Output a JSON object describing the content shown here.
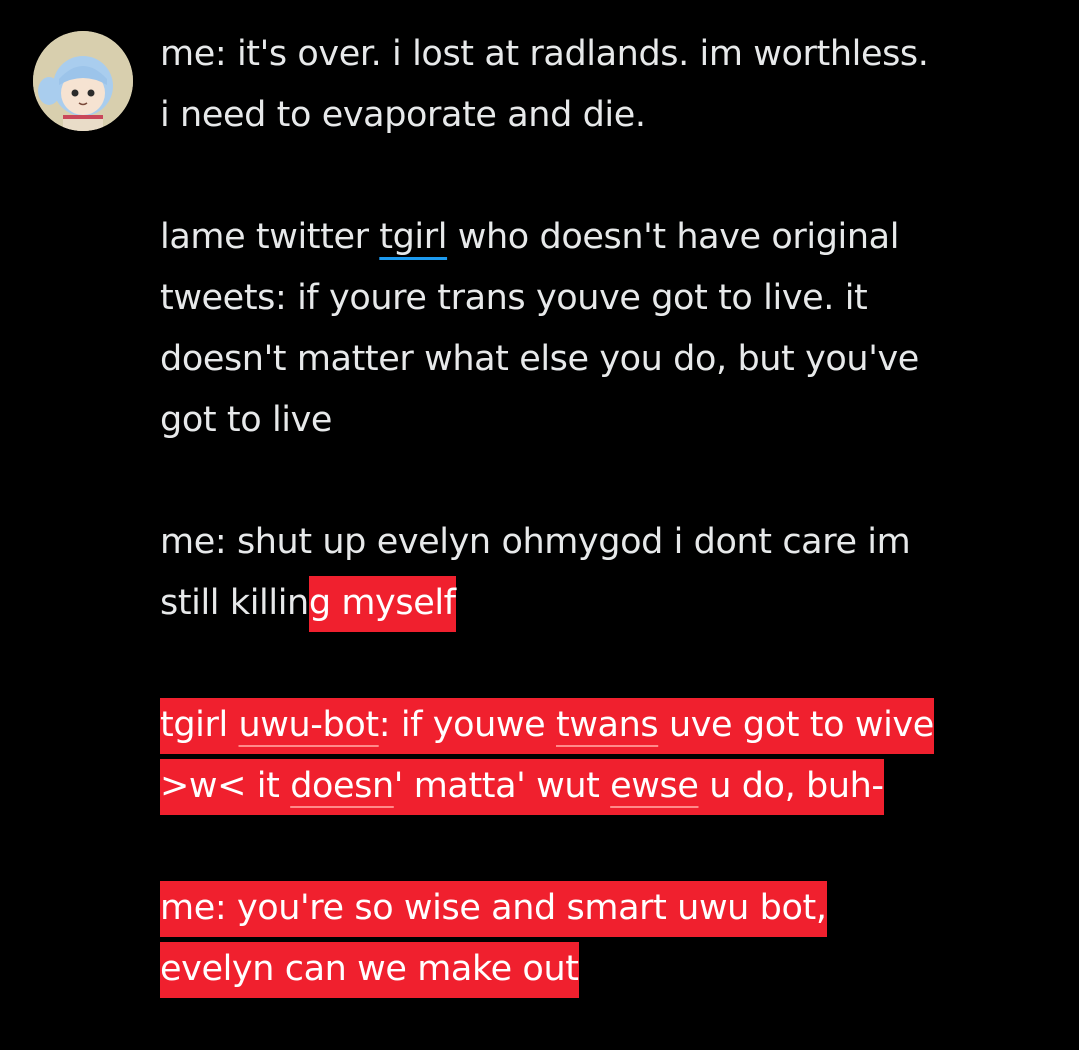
{
  "tweet": {
    "avatar_icon": "anime-girl-avatar-icon",
    "highlight_color": "#f0202e",
    "mention_underline_color": "#1d9bf0",
    "p1": {
      "line1": "me: it's over. i lost at radlands. im worthless.",
      "line2": "i need to evaporate and die."
    },
    "p2": {
      "line1_a": "lame twitter ",
      "line1_mention": "tgirl",
      "line1_b": " who doesn't have original",
      "line2": "tweets: if youre trans youve got to live. it",
      "line3": "doesn't matter what else you do, but you've",
      "line4": "got to live"
    },
    "p3": {
      "line1": "me: shut up evelyn ohmygod i dont care im",
      "line2_a": "still killin",
      "line2_hl": "g myself"
    },
    "p4": {
      "l1_a": "tgirl ",
      "l1_w1": "uwu-bot",
      "l1_b": ": if youwe ",
      "l1_w2": "twans",
      "l1_c": " uve got to wive",
      "l2_a": ">w< it ",
      "l2_w1": "doesn",
      "l2_b": "' matta' wut ",
      "l2_w2": "ewse",
      "l2_c": " u do, buh-"
    },
    "p5": {
      "line1": "me: you're so wise and smart uwu bot,",
      "line2": "evelyn can we make out"
    }
  }
}
